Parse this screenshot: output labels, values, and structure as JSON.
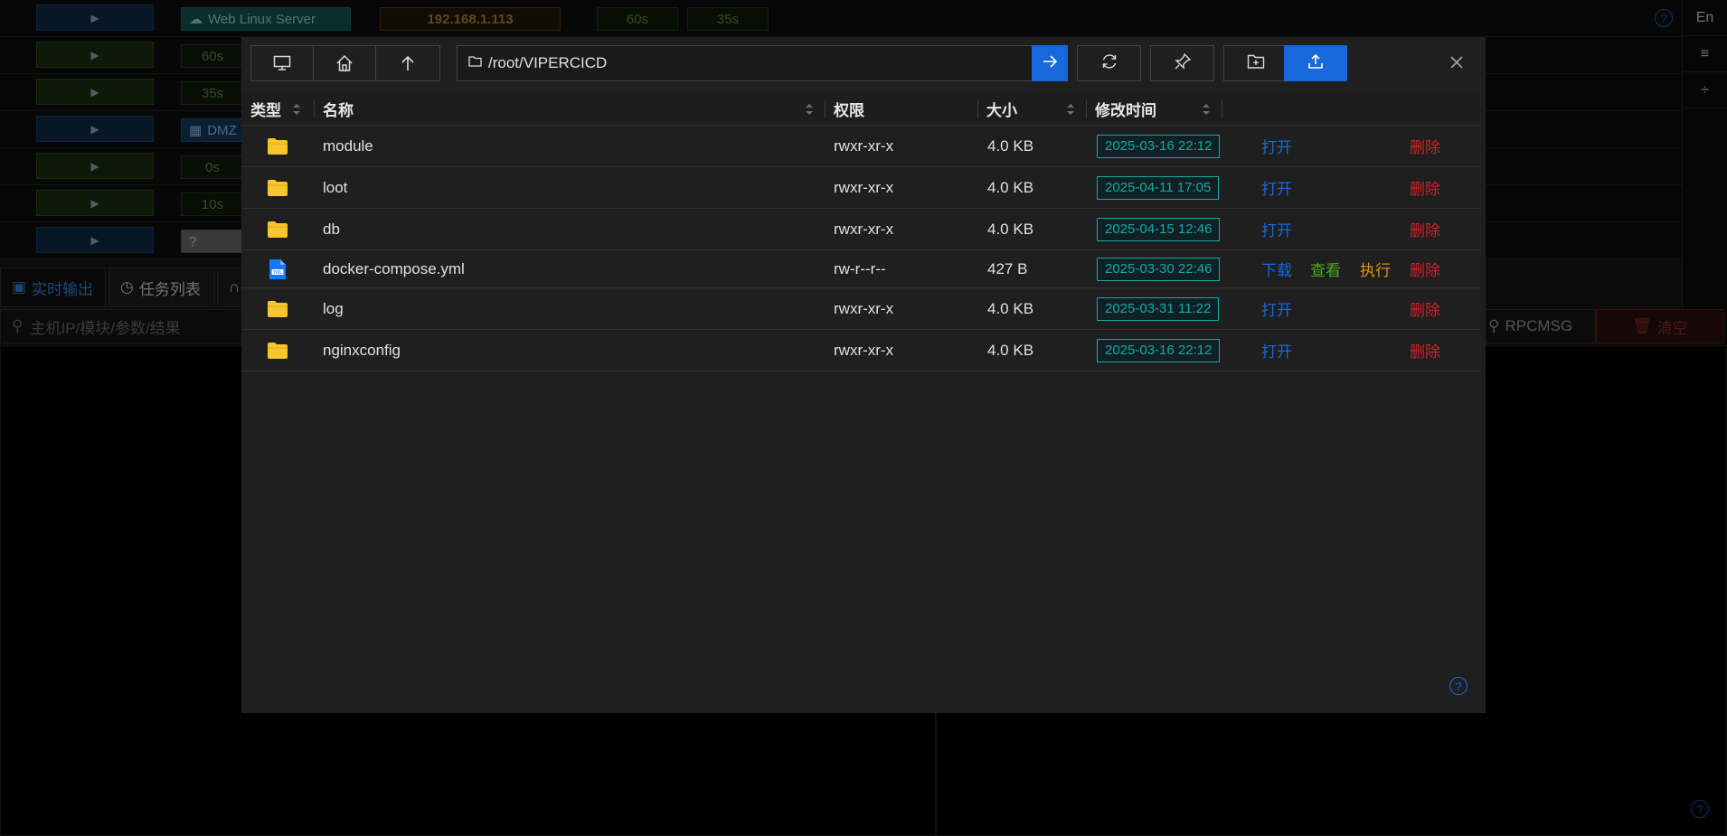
{
  "background": {
    "hosts": [
      {
        "button_icon": "play-icon",
        "tag": "Web Linux Server",
        "ip": "192.168.1.113",
        "t1": "60s",
        "t2": "35s"
      },
      {
        "button_icon": "play-icon",
        "tag": "60s"
      },
      {
        "button_icon": "play-icon",
        "tag": "35s"
      },
      {
        "button_icon": "play-icon",
        "tag": "DMZ"
      },
      {
        "button_icon": "play-icon",
        "tag": "0s"
      },
      {
        "button_icon": "play-icon",
        "tag": "10s"
      },
      {
        "button_icon": "play-icon",
        "tag": "?"
      }
    ],
    "lang_toggle": "En",
    "tabs": [
      {
        "label": "实时输出",
        "icon": "terminal-icon"
      },
      {
        "label": "任务列表",
        "icon": "clock-icon"
      }
    ],
    "search_placeholder": "主机IP/模块/参数/结果",
    "rpc_label": "RPCMSG",
    "clear_label": "清空"
  },
  "file_browser": {
    "path": "/root/VIPERCICD",
    "toolbar": {
      "icons": [
        "desktop-icon",
        "home-icon",
        "arrow-up-icon"
      ],
      "go_icon": "arrow-right-icon",
      "refresh_icon": "refresh-icon",
      "pin_icon": "pin-icon",
      "new_folder_icon": "folder-add-icon",
      "upload_icon": "upload-icon"
    },
    "columns": {
      "type": "类型",
      "name": "名称",
      "permission": "权限",
      "size": "大小",
      "modified": "修改时间"
    },
    "rows": [
      {
        "type": "folder",
        "name": "module",
        "permission": "rwxr-xr-x",
        "size": "4.0 KB",
        "modified": "2025-03-16 22:12",
        "actions": [
          "打开",
          "删除"
        ]
      },
      {
        "type": "folder",
        "name": "loot",
        "permission": "rwxr-xr-x",
        "size": "4.0 KB",
        "modified": "2025-04-11 17:05",
        "actions": [
          "打开",
          "删除"
        ]
      },
      {
        "type": "folder",
        "name": "db",
        "permission": "rwxr-xr-x",
        "size": "4.0 KB",
        "modified": "2025-04-15 12:46",
        "actions": [
          "打开",
          "删除"
        ]
      },
      {
        "type": "file",
        "name": "docker-compose.yml",
        "permission": "rw-r--r--",
        "size": "427 B",
        "modified": "2025-03-30 22:46",
        "actions": [
          "下载",
          "查看",
          "执行",
          "删除"
        ]
      },
      {
        "type": "folder",
        "name": "log",
        "permission": "rwxr-xr-x",
        "size": "4.0 KB",
        "modified": "2025-03-31 11:22",
        "actions": [
          "打开",
          "删除"
        ]
      },
      {
        "type": "folder",
        "name": "nginxconfig",
        "permission": "rwxr-xr-x",
        "size": "4.0 KB",
        "modified": "2025-03-16 22:12",
        "actions": [
          "打开",
          "删除"
        ]
      }
    ],
    "colors": {
      "accent": "#1668dc",
      "open": "#1668dc",
      "view": "#49aa19",
      "execute": "#d89614",
      "delete": "#d32029",
      "time_tag": "#13a8a8",
      "folder": "#f7c52d"
    }
  }
}
